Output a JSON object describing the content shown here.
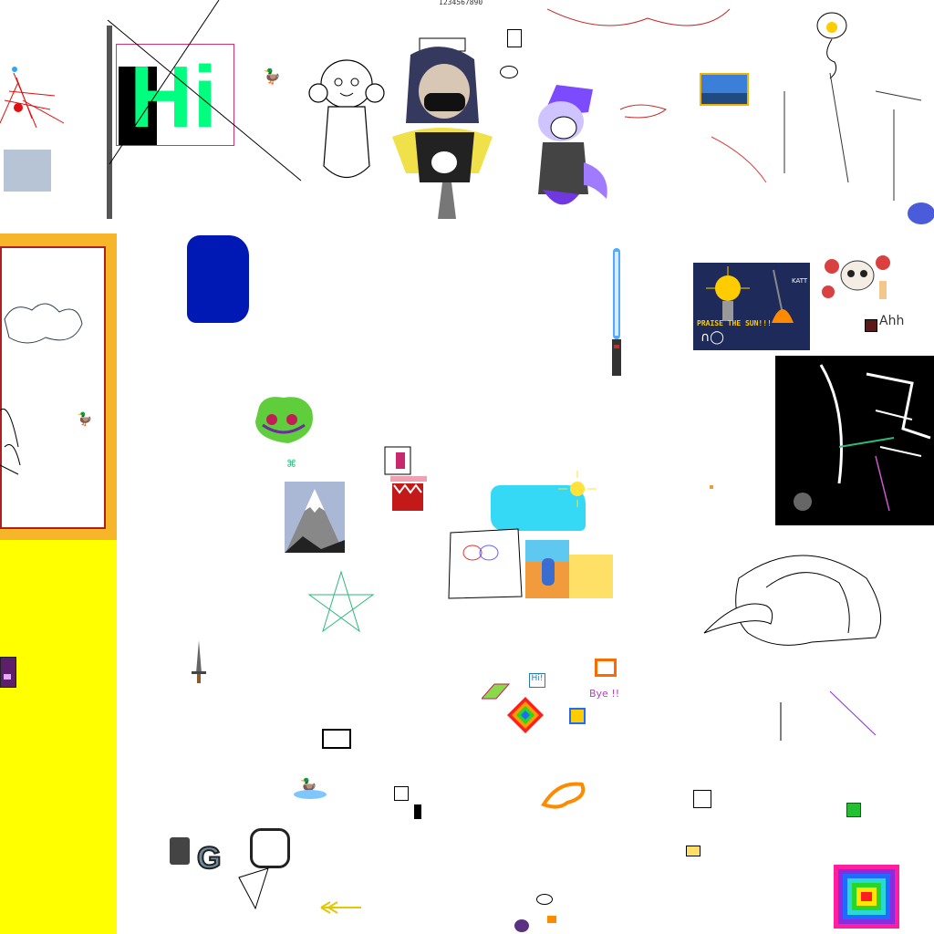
{
  "canvas": {
    "background": "#ffffff",
    "texts": {
      "number_strip": "1234567890",
      "hi": "Hi",
      "praise": "PRAISE THE SUN!!!",
      "ah": "Ahh",
      "bye": "Bye !!",
      "tiny_hi": "Hi!",
      "katt": "KATT"
    },
    "colors": {
      "frame_orange": "#f7b52a",
      "yellow_panel": "#ffff00",
      "blue_blob": "#0018b4",
      "green_creature": "#5fcd3c",
      "cyan_cloud": "#35d8f5",
      "lightsaber_blue": "#54a8ff",
      "dark_panel": "#1d2a5a"
    },
    "icons": [
      "duck-icon",
      "sword-icon",
      "lightsaber-icon",
      "skull-icon",
      "sun-icon",
      "pentagram-icon",
      "mountain-icon",
      "rainbow-square-icon",
      "shell-icon"
    ]
  }
}
